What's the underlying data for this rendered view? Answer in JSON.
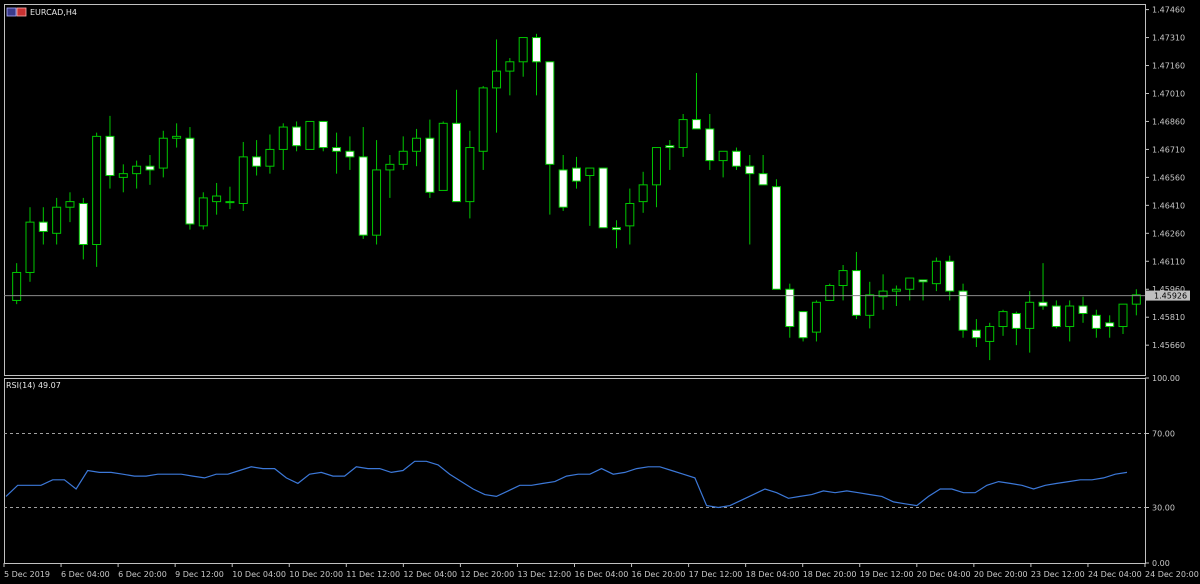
{
  "colors": {
    "background": "#000000",
    "frame": "#c0c0c0",
    "bull_body": "#000000",
    "bear_body": "#ffffff",
    "candle_outline": "#00c800",
    "wick": "#00c800",
    "price_line": "#8a8a8a",
    "rsi_line": "#3c78d8",
    "rsi_levels": "#a0a0a0",
    "text": "#e6e6e6"
  },
  "symbol_icon": "window-icon",
  "symbol_label": "EURCAD,H4",
  "price_tag": "1.45926",
  "rsi_label": "RSI(14) 49.07",
  "chart_data": [
    {
      "type": "candlestick",
      "title": "EURCAD,H4",
      "y_ticks": [
        "1.47460",
        "1.47310",
        "1.47160",
        "1.47010",
        "1.46860",
        "1.46710",
        "1.46560",
        "1.46410",
        "1.46260",
        "1.46110",
        "1.45960",
        "1.45810",
        "1.45660"
      ],
      "ylim": [
        1.455,
        1.4749
      ],
      "current_price": 1.45926,
      "x_labels": [
        "5 Dec 2019",
        "6 Dec 04:00",
        "6 Dec 20:00",
        "9 Dec 12:00",
        "10 Dec 04:00",
        "10 Dec 20:00",
        "11 Dec 12:00",
        "12 Dec 04:00",
        "12 Dec 20:00",
        "13 Dec 12:00",
        "16 Dec 04:00",
        "16 Dec 20:00",
        "17 Dec 12:00",
        "18 Dec 04:00",
        "18 Dec 20:00",
        "19 Dec 12:00",
        "20 Dec 04:00",
        "20 Dec 20:00",
        "23 Dec 12:00",
        "24 Dec 04:00",
        "24 Dec 20:00"
      ],
      "ohlc": [
        [
          1.459,
          1.461,
          1.4588,
          1.4605
        ],
        [
          1.4605,
          1.464,
          1.46,
          1.4632
        ],
        [
          1.4632,
          1.464,
          1.462,
          1.4627
        ],
        [
          1.4626,
          1.4645,
          1.462,
          1.464
        ],
        [
          1.464,
          1.4648,
          1.4632,
          1.4643
        ],
        [
          1.4642,
          1.4645,
          1.4612,
          1.462
        ],
        [
          1.462,
          1.468,
          1.4608,
          1.4678
        ],
        [
          1.4678,
          1.4689,
          1.465,
          1.4657
        ],
        [
          1.4656,
          1.4663,
          1.4648,
          1.4658
        ],
        [
          1.4658,
          1.4665,
          1.465,
          1.4662
        ],
        [
          1.4662,
          1.4668,
          1.4652,
          1.466
        ],
        [
          1.4661,
          1.4681,
          1.4656,
          1.4677
        ],
        [
          1.4677,
          1.4685,
          1.4672,
          1.4678
        ],
        [
          1.4677,
          1.4683,
          1.4628,
          1.4631
        ],
        [
          1.463,
          1.4648,
          1.4628,
          1.4645
        ],
        [
          1.4643,
          1.4653,
          1.4636,
          1.4646
        ],
        [
          1.4643,
          1.4651,
          1.4639,
          1.4643
        ],
        [
          1.4642,
          1.4675,
          1.4638,
          1.4667
        ],
        [
          1.4667,
          1.4676,
          1.4657,
          1.4662
        ],
        [
          1.4662,
          1.4679,
          1.4658,
          1.4671
        ],
        [
          1.4671,
          1.4685,
          1.466,
          1.4683
        ],
        [
          1.4683,
          1.4686,
          1.467,
          1.4673
        ],
        [
          1.4671,
          1.4684,
          1.4672,
          1.4686
        ],
        [
          1.4686,
          1.4686,
          1.467,
          1.4672
        ],
        [
          1.4672,
          1.468,
          1.4658,
          1.467
        ],
        [
          1.467,
          1.4678,
          1.466,
          1.4667
        ],
        [
          1.4667,
          1.4683,
          1.4623,
          1.4625
        ],
        [
          1.4625,
          1.4676,
          1.462,
          1.466
        ],
        [
          1.466,
          1.4668,
          1.4645,
          1.4663
        ],
        [
          1.4663,
          1.4678,
          1.466,
          1.467
        ],
        [
          1.467,
          1.4682,
          1.4662,
          1.4677
        ],
        [
          1.4677,
          1.4687,
          1.4645,
          1.4648
        ],
        [
          1.4649,
          1.4686,
          1.4649,
          1.4685
        ],
        [
          1.4685,
          1.4703,
          1.4645,
          1.4643
        ],
        [
          1.4643,
          1.4681,
          1.4634,
          1.4672
        ],
        [
          1.467,
          1.4705,
          1.466,
          1.4704
        ],
        [
          1.4704,
          1.473,
          1.468,
          1.4713
        ],
        [
          1.4713,
          1.472,
          1.47,
          1.4718
        ],
        [
          1.4718,
          1.4723,
          1.471,
          1.4731
        ],
        [
          1.4731,
          1.4733,
          1.47,
          1.4718
        ],
        [
          1.4718,
          1.471,
          1.4636,
          1.4663
        ],
        [
          1.466,
          1.4668,
          1.4638,
          1.464
        ],
        [
          1.4661,
          1.4667,
          1.465,
          1.4654
        ],
        [
          1.4657,
          1.466,
          1.463,
          1.4661
        ],
        [
          1.4661,
          1.4661,
          1.463,
          1.4629
        ],
        [
          1.4629,
          1.4633,
          1.4618,
          1.4628
        ],
        [
          1.463,
          1.465,
          1.462,
          1.4642
        ],
        [
          1.4643,
          1.4659,
          1.4637,
          1.4652
        ],
        [
          1.4652,
          1.467,
          1.464,
          1.4672
        ],
        [
          1.4673,
          1.4676,
          1.466,
          1.4672
        ],
        [
          1.4672,
          1.469,
          1.4667,
          1.4687
        ],
        [
          1.4687,
          1.4712,
          1.4685,
          1.4682
        ],
        [
          1.4682,
          1.469,
          1.466,
          1.4665
        ],
        [
          1.4665,
          1.467,
          1.4656,
          1.467
        ],
        [
          1.467,
          1.4672,
          1.466,
          1.4662
        ],
        [
          1.4662,
          1.4668,
          1.462,
          1.4658
        ],
        [
          1.4658,
          1.4668,
          1.4652,
          1.4652
        ],
        [
          1.4651,
          1.4655,
          1.462,
          1.4596
        ],
        [
          1.4596,
          1.4599,
          1.457,
          1.4576
        ],
        [
          1.4584,
          1.4584,
          1.4568,
          1.457
        ],
        [
          1.4573,
          1.459,
          1.4568,
          1.4589
        ],
        [
          1.459,
          1.4599,
          1.4592,
          1.4598
        ],
        [
          1.4598,
          1.4609,
          1.459,
          1.4606
        ],
        [
          1.4606,
          1.4616,
          1.458,
          1.4582
        ],
        [
          1.4582,
          1.46,
          1.4575,
          1.4593
        ],
        [
          1.4592,
          1.4604,
          1.4585,
          1.4595
        ],
        [
          1.4595,
          1.4598,
          1.4587,
          1.4596
        ],
        [
          1.4596,
          1.4601,
          1.459,
          1.4602
        ],
        [
          1.4601,
          1.46,
          1.459,
          1.46
        ],
        [
          1.4599,
          1.4613,
          1.4595,
          1.4611
        ],
        [
          1.4611,
          1.4614,
          1.459,
          1.4595
        ],
        [
          1.4595,
          1.4599,
          1.457,
          1.4574
        ],
        [
          1.4574,
          1.458,
          1.4565,
          1.457
        ],
        [
          1.4568,
          1.4578,
          1.4558,
          1.4576
        ],
        [
          1.4576,
          1.4585,
          1.4571,
          1.4584
        ],
        [
          1.4583,
          1.4584,
          1.4566,
          1.4575
        ],
        [
          1.4575,
          1.4595,
          1.4562,
          1.4589
        ],
        [
          1.4589,
          1.461,
          1.4585,
          1.4587
        ],
        [
          1.4587,
          1.459,
          1.4575,
          1.4576
        ],
        [
          1.4576,
          1.459,
          1.4568,
          1.4587
        ],
        [
          1.4587,
          1.4592,
          1.4578,
          1.4583
        ],
        [
          1.4582,
          1.4585,
          1.457,
          1.4575
        ],
        [
          1.4578,
          1.4582,
          1.457,
          1.4576
        ],
        [
          1.4576,
          1.4586,
          1.4572,
          1.4588
        ],
        [
          1.4588,
          1.4596,
          1.4582,
          1.4593
        ]
      ]
    },
    {
      "type": "line",
      "name": "RSI(14)",
      "current_value": 49.07,
      "y_ticks": [
        "100.00",
        "70.00",
        "30.00",
        "0.00"
      ],
      "ylim": [
        0,
        100
      ],
      "levels": [
        70,
        30
      ],
      "values": [
        36,
        42,
        42,
        42,
        45,
        45,
        40,
        50,
        49,
        49,
        48,
        47,
        47,
        48,
        48,
        48,
        47,
        46,
        48,
        48,
        50,
        52,
        51,
        51,
        46,
        43,
        48,
        49,
        47,
        47,
        52,
        51,
        51,
        49,
        50,
        55,
        55,
        53,
        48,
        44,
        40,
        37,
        36,
        39,
        42,
        42,
        43,
        44,
        47,
        48,
        48,
        51,
        48,
        49,
        51,
        52,
        52,
        50,
        48,
        46,
        31,
        30,
        31,
        34,
        37,
        40,
        38,
        35,
        36,
        37,
        39,
        38,
        39,
        38,
        37,
        36,
        33,
        32,
        31,
        36,
        40,
        40,
        38,
        38,
        42,
        44,
        43,
        42,
        40,
        42,
        43,
        44,
        45,
        45,
        46,
        48,
        49
      ]
    }
  ]
}
